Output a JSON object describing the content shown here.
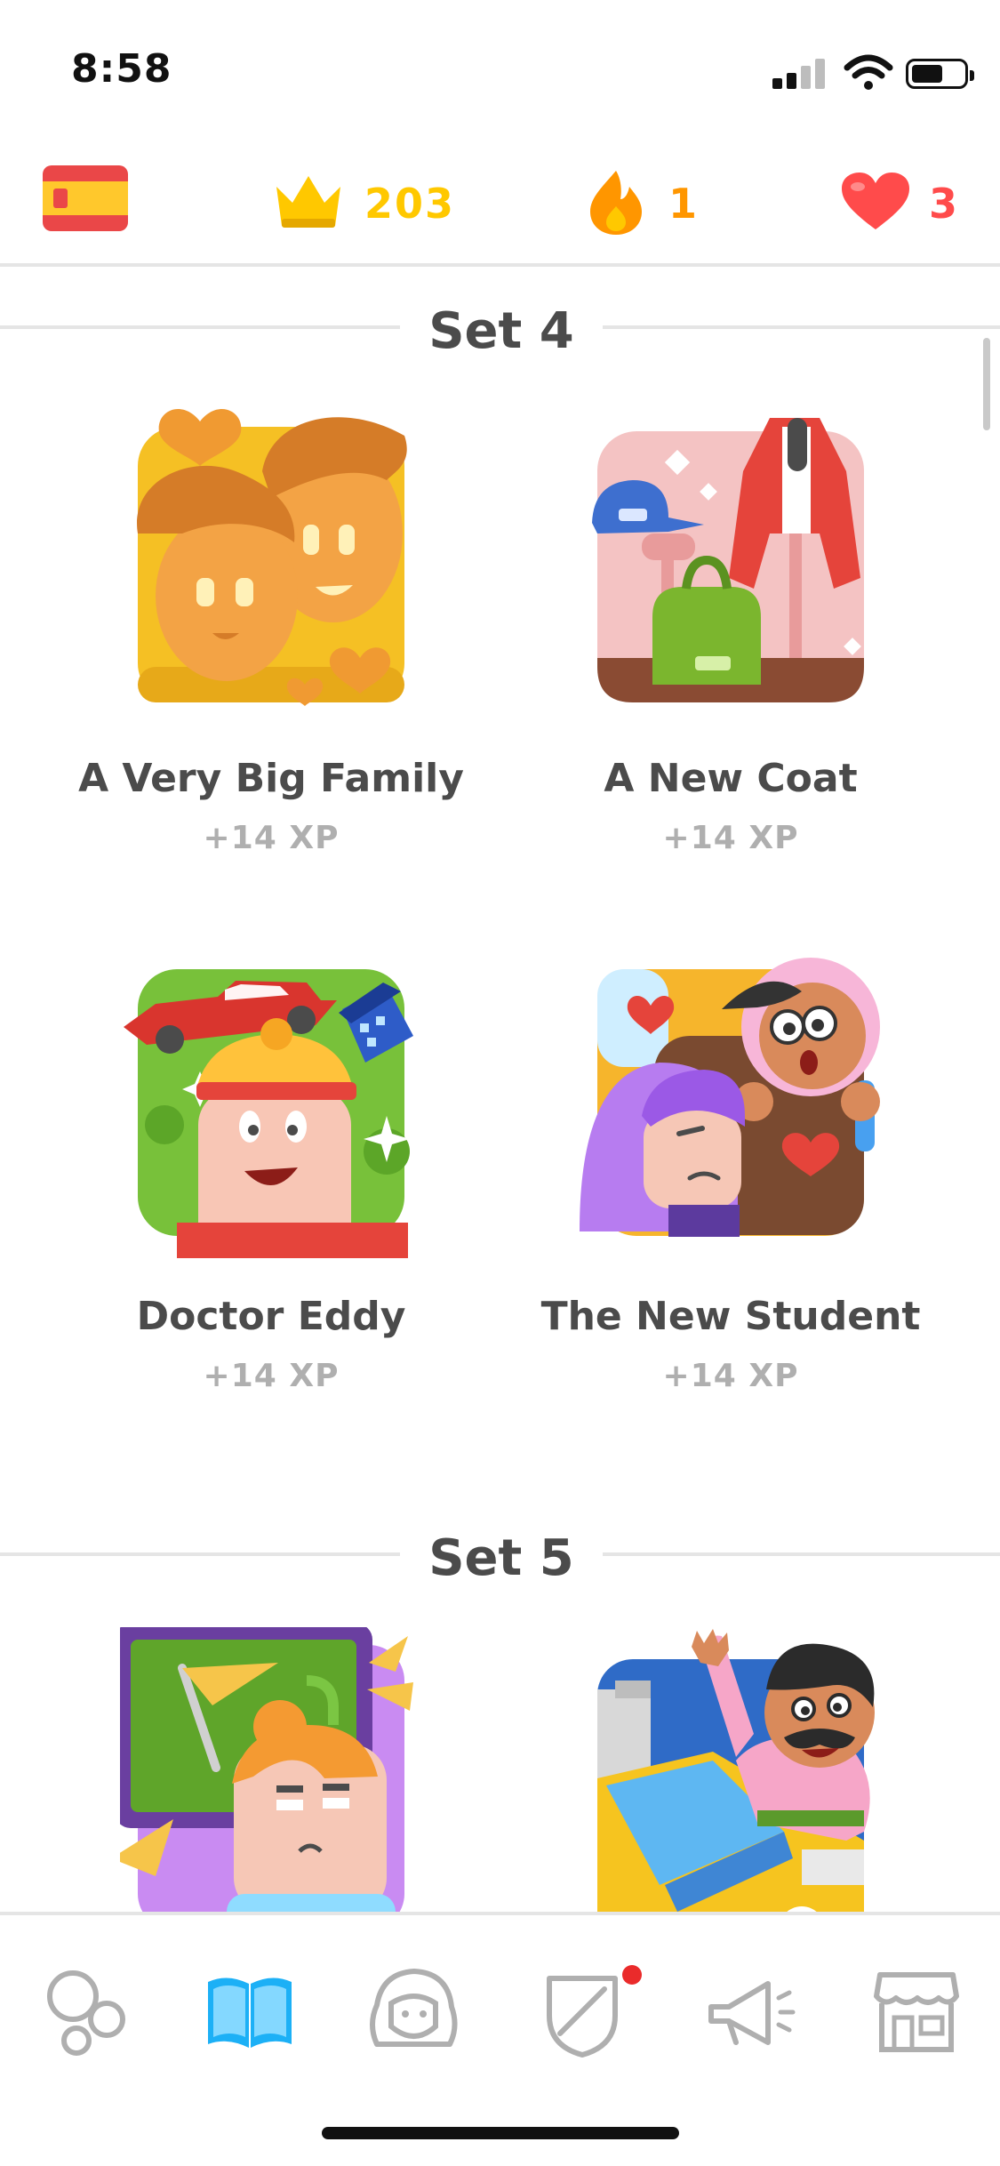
{
  "status_bar": {
    "time": "8:58",
    "signal_bars_filled": 2,
    "signal_bars_total": 4,
    "battery_level": 0.55
  },
  "stats": {
    "language_flag": "spain-flag-icon",
    "crowns": "203",
    "streak": "1",
    "hearts": "3"
  },
  "sets": [
    {
      "title": "Set 4",
      "stories": [
        {
          "title": "A Very Big Family",
          "xp": "+14 XP",
          "art": "big-family-illustration"
        },
        {
          "title": "A New Coat",
          "xp": "+14 XP",
          "art": "new-coat-illustration"
        },
        {
          "title": "Doctor Eddy",
          "xp": "+14 XP",
          "art": "doctor-eddy-illustration"
        },
        {
          "title": "The New Student",
          "xp": "+14 XP",
          "art": "new-student-illustration"
        }
      ]
    },
    {
      "title": "Set 5",
      "stories": [
        {
          "title": "",
          "xp": "",
          "art": "classroom-illustration"
        },
        {
          "title": "",
          "xp": "",
          "art": "taxi-wave-illustration"
        }
      ]
    }
  ],
  "bottom_nav": {
    "items": [
      {
        "icon": "learn-bubbles-icon",
        "active": false
      },
      {
        "icon": "stories-book-icon",
        "active": true
      },
      {
        "icon": "profile-face-icon",
        "active": false
      },
      {
        "icon": "leagues-shield-icon",
        "active": false,
        "badge": true
      },
      {
        "icon": "announcements-megaphone-icon",
        "active": false
      },
      {
        "icon": "shop-store-icon",
        "active": false
      }
    ]
  },
  "colors": {
    "crown": "#ffc800",
    "streak": "#ff9600",
    "heart": "#ff4b4b",
    "active_tab": "#1cb0f6",
    "inactive_icon": "#afafaf",
    "divider": "#e5e5e5"
  }
}
